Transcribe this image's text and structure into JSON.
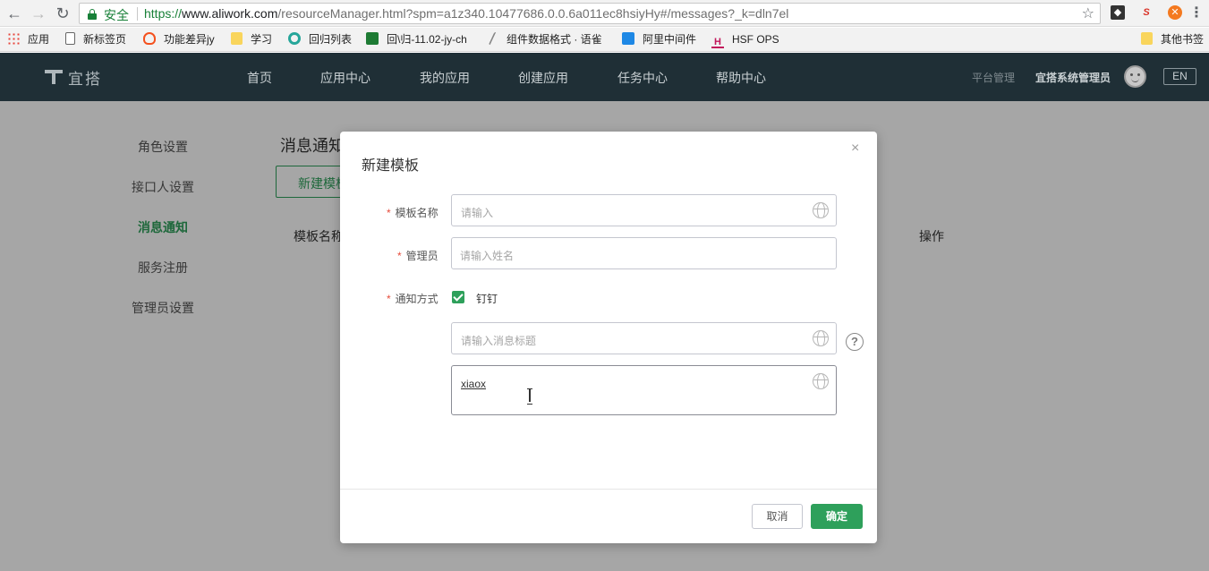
{
  "browser": {
    "secure_label": "安全",
    "url_scheme": "https://",
    "url_host": "www.aliwork.com",
    "url_path": "/resourceManager.html?spm=a1z340.10477686.0.0.6a011ec8hsiyHy#/messages?_k=dln7el",
    "bookmarks": [
      {
        "label": "应用",
        "icon": "apps-grid-icon",
        "color": "#e8453c"
      },
      {
        "label": "新标签页",
        "icon": "page-icon",
        "color": "#ffffff"
      },
      {
        "label": "功能差异jy",
        "icon": "lightbulb-icon",
        "color": "#f4511e"
      },
      {
        "label": "学习",
        "icon": "folder-icon",
        "color": "#f9d55c"
      },
      {
        "label": "回归列表",
        "icon": "refresh-site-icon",
        "color": "#26a69a"
      },
      {
        "label": "回\\归-11.02-jy-ch",
        "icon": "yuque-icon",
        "color": "#1e7b34"
      },
      {
        "label": "组件数据格式 · 语雀",
        "icon": "feather-icon",
        "color": "#888888"
      },
      {
        "label": "阿里中间件",
        "icon": "middleware-icon",
        "color": "#1e88e5"
      },
      {
        "label": "HSF OPS",
        "icon": "hsf-icon",
        "color": "#c2185b"
      }
    ],
    "other_bookmarks": "其他书签"
  },
  "app": {
    "logo_text": "宜搭",
    "nav": [
      "首页",
      "应用中心",
      "我的应用",
      "创建应用",
      "任务中心",
      "帮助中心"
    ],
    "platform_admin": "平台管理",
    "user_name": "宜搭系统管理员",
    "lang": "EN"
  },
  "sidebar": {
    "items": [
      "角色设置",
      "接口人设置",
      "消息通知",
      "服务注册",
      "管理员设置"
    ],
    "active": "消息通知"
  },
  "page": {
    "title": "消息通知",
    "new_button": "新建模板",
    "col_name": "模板名称",
    "col_action": "操作"
  },
  "modal": {
    "title": "新建模板",
    "close": "×",
    "fields": {
      "name_label": "模板名称",
      "name_placeholder": "请输入",
      "admin_label": "管理员",
      "admin_placeholder": "请输入姓名",
      "notify_label": "通知方式",
      "notify_option": "钉钉",
      "notify_checked": true,
      "msg_title_placeholder": "请输入消息标题",
      "msg_body_value": "xiaox"
    },
    "help": "?",
    "cancel": "取消",
    "ok": "确定"
  },
  "colors": {
    "brand_green": "#2ea05b",
    "header_bg": "#1f2f36",
    "required": "#e74c3c"
  }
}
